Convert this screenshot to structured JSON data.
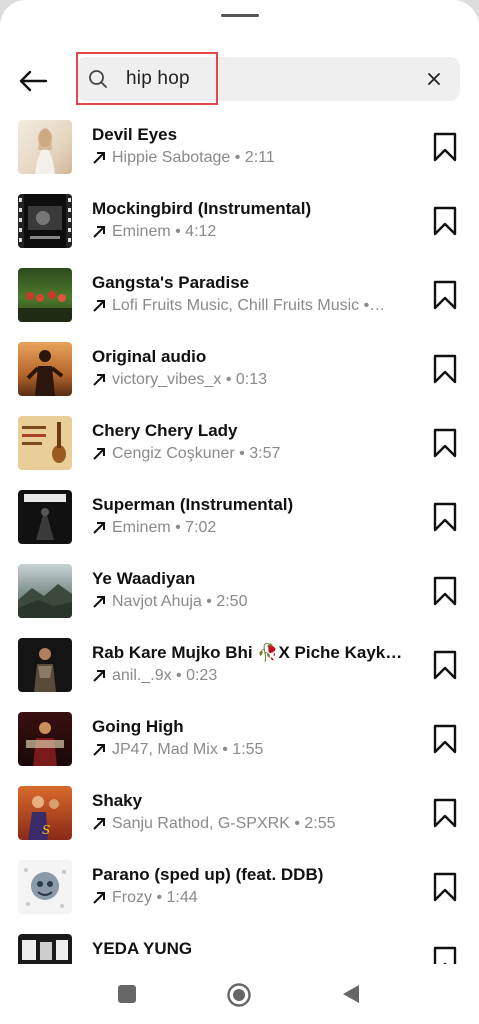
{
  "search": {
    "query": "hip hop"
  },
  "icons": {
    "back": "arrow-left-icon",
    "search": "search-icon",
    "clear": "close-icon",
    "trend": "arrow-up-right-icon",
    "save": "bookmark-icon"
  },
  "colors": {
    "highlight": "#e4484d",
    "subtitle": "#8a8a8a",
    "search_bg": "#efefef"
  },
  "results": [
    {
      "title": "Devil Eyes",
      "subtitle": "Hippie Sabotage • 2:11"
    },
    {
      "title": "Mockingbird (Instrumental)",
      "subtitle": "Eminem • 4:12"
    },
    {
      "title": "Gangsta's Paradise",
      "subtitle": "Lofi Fruits Music, Chill Fruits Music •…"
    },
    {
      "title": "Original audio",
      "subtitle": "victory_vibes_x • 0:13"
    },
    {
      "title": "Chery Chery Lady",
      "subtitle": "Cengiz Coşkuner • 3:57"
    },
    {
      "title": "Superman (Instrumental)",
      "subtitle": "Eminem • 7:02"
    },
    {
      "title": "Ye Waadiyan",
      "subtitle": "Navjot Ahuja • 2:50"
    },
    {
      "title": "Rab Kare Mujko Bhi 🥀X Piche Kayku ...",
      "subtitle": "anil._.9x • 0:23"
    },
    {
      "title": "Going High",
      "subtitle": "JP47, Mad Mix • 1:55"
    },
    {
      "title": "Shaky",
      "subtitle": "Sanju Rathod, G-SPXRK • 2:55"
    },
    {
      "title": "Parano (sped up) (feat. DDB)",
      "subtitle": "Frozy • 1:44"
    },
    {
      "title": "YEDA YUNG",
      "subtitle": ""
    }
  ]
}
